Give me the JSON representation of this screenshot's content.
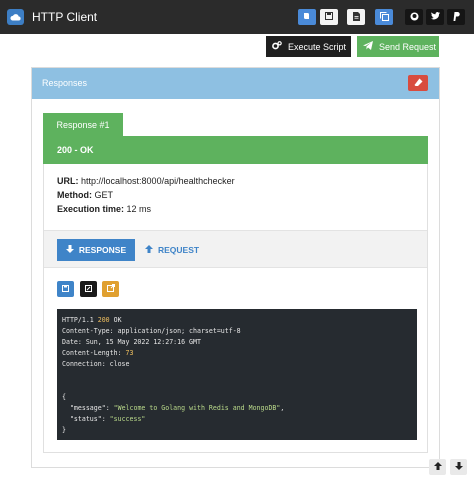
{
  "header": {
    "title": "HTTP Client",
    "icons": [
      "cloud-icon",
      "book-icon",
      "save-icon",
      "file-icon",
      "copy-icon",
      "github-icon",
      "twitter-icon",
      "paypal-icon"
    ]
  },
  "toolbar": {
    "execute_label": "Execute Script",
    "send_label": "Send Request"
  },
  "panel": {
    "title": "Responses",
    "tab_label": "Response #1",
    "status": "200 - OK",
    "url_label": "URL:",
    "url_value": "http://localhost:8000/api/healthchecker",
    "method_label": "Method:",
    "method_value": "GET",
    "time_label": "Execution time:",
    "time_value": "12 ms",
    "response_tab": "RESPONSE",
    "request_tab": "REQUEST"
  },
  "code": {
    "status_prefix": "HTTP/1.1 ",
    "status_code": "200",
    "status_suffix": " OK",
    "h1_key": "Content-Type:",
    "h1_val": " application/json; charset=utf-8",
    "h2_key": "Date:",
    "h2_val": " Sun, 15 May 2022 12:27:16 GMT",
    "h3_key": "Content-Length:",
    "h3_val": " 73",
    "h4_key": "Connection:",
    "h4_val": " close",
    "open_brace": "{",
    "m_key": "\"message\"",
    "m_val": "\"Welcome to Golang with Redis and MongoDB\"",
    "s_key": "\"status\"",
    "s_val": "\"success\"",
    "close_brace": "}"
  },
  "colors": {
    "topbar": "#2b2b2b",
    "accent_blue": "#4a8ad8",
    "success_green": "#5eb25e",
    "danger_red": "#d84c3f",
    "panel_head": "#8ec0e2"
  }
}
